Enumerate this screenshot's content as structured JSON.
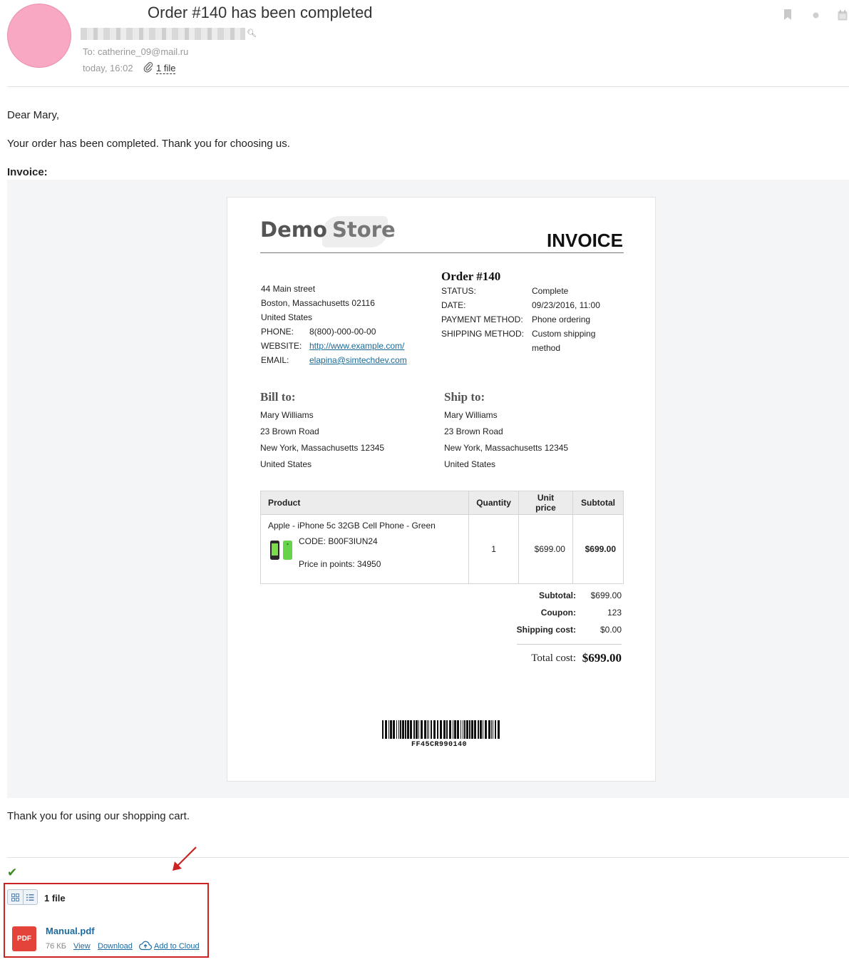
{
  "email": {
    "subject": "Order #140 has been completed",
    "to": "To: catherine_09@mail.ru",
    "date": "today, 16:02",
    "attachments_link": "1 file"
  },
  "message": {
    "greeting": "Dear Mary,",
    "intro": "Your order has been completed. Thank you for choosing us.",
    "invoice_label": "Invoice:",
    "closing": "Thank you for using our shopping cart."
  },
  "invoice": {
    "logo_word1": "Demo",
    "logo_word2": "Store",
    "title": "INVOICE",
    "company": {
      "street": "44 Main street",
      "city": "Boston, Massachusetts 02116",
      "country": "United States",
      "phone_label": "PHONE:",
      "phone": "8(800)-000-00-00",
      "website_label": "WEBSITE:",
      "website": "http://www.example.com/",
      "email_label": "EMAIL:",
      "email": "elapina@simtechdev.com"
    },
    "order": {
      "heading": "Order #140",
      "status_label": "STATUS:",
      "status": "Complete",
      "date_label": "DATE:",
      "date": "09/23/2016, 11:00",
      "payment_label": "PAYMENT METHOD:",
      "payment": "Phone ordering",
      "shipping_label": "SHIPPING METHOD:",
      "shipping_line1": "Custom shipping",
      "shipping_line2": "method"
    },
    "bill_to": {
      "heading": "Bill to:",
      "name": "Mary Williams",
      "street": "23 Brown Road",
      "city": "New York, Massachusetts 12345",
      "country": "United States"
    },
    "ship_to": {
      "heading": "Ship to:",
      "name": "Mary Williams",
      "street": "23 Brown Road",
      "city": "New York, Massachusetts 12345",
      "country": "United States"
    },
    "table": {
      "headers": [
        "Product",
        "Quantity",
        "Unit price",
        "Subtotal"
      ],
      "item": {
        "name": "Apple - iPhone 5c 32GB Cell Phone - Green",
        "code": "CODE: B00F3IUN24",
        "points": "Price in points: 34950",
        "quantity": "1",
        "unit_price": "$699.00",
        "subtotal": "$699.00"
      }
    },
    "totals": {
      "subtotal_label": "Subtotal:",
      "subtotal": "$699.00",
      "coupon_label": "Coupon:",
      "coupon": "123",
      "shipping_label": "Shipping cost:",
      "shipping": "$0.00",
      "total_label": "Total cost:",
      "total": "$699.00"
    },
    "barcode_text": "FF45CR990140"
  },
  "attachments": {
    "count_label": "1 file",
    "file_name": "Manual.pdf",
    "file_type": "PDF",
    "file_size": "76 КБ",
    "view": "View",
    "download": "Download",
    "add_to_cloud": "Add to Cloud"
  },
  "colors": {
    "avatar": "#f9a8c4",
    "link": "#1a6a95",
    "highlight_box": "#cc2222",
    "pdf_icon": "#e4433a"
  }
}
